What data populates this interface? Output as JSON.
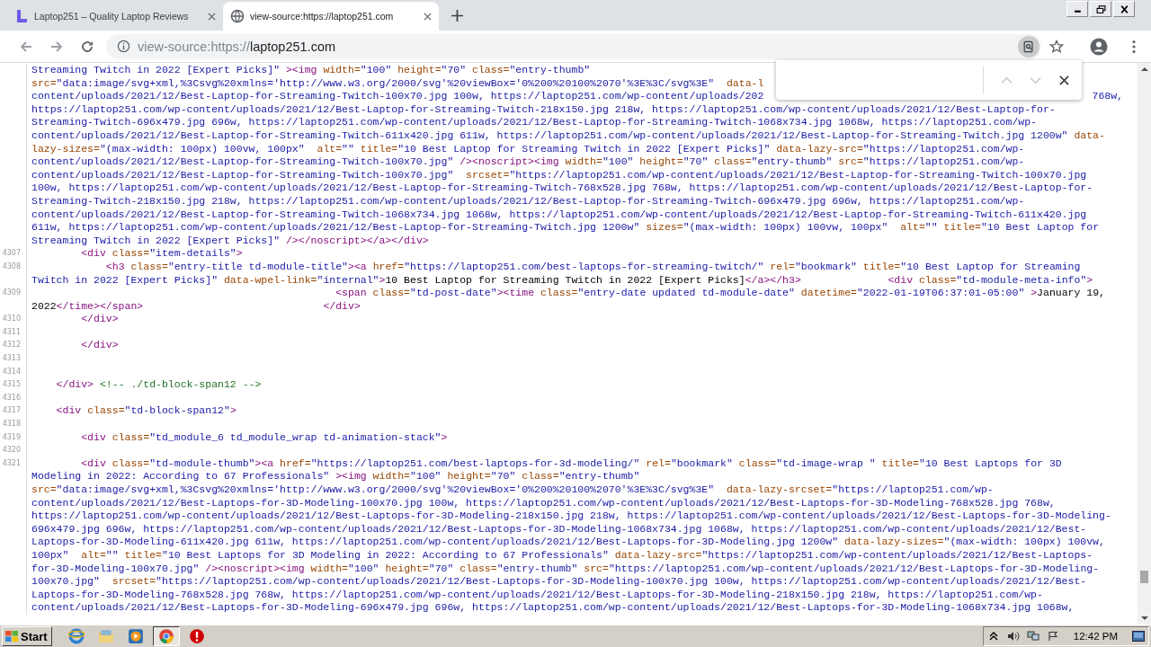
{
  "tabs": [
    {
      "title": "Laptop251 – Quality Laptop Reviews",
      "selected": false
    },
    {
      "title": "view-source:https://laptop251.com",
      "selected": true
    }
  ],
  "address_bar": {
    "scheme": "view-source:https://",
    "host": "laptop251.com"
  },
  "source_lines": [
    {
      "text": "Streaming Twitch in 2022 [Expert Picks]\" ><img width=\"100\" height=\"70\" class=\"entry-thumb\""
    },
    {
      "text": "src=\"data:image/svg+xml,%3Csvg%20xmlns='http://www.w3.org/2000/svg'%20viewBox='0%200%20100%2070'%3E%3C/svg%3E\"  data-l"
    },
    {
      "text": "content/uploads/2021/12/Best-Laptop-for-Streaming-Twitch-100x70.jpg 100w, https://laptop251.com/wp-content/uploads/202",
      "tail": "768w,"
    },
    {
      "text": "https://laptop251.com/wp-content/uploads/2021/12/Best-Laptop-for-Streaming-Twitch-218x150.jpg 218w, https://laptop251.com/wp-content/uploads/2021/12/Best-Laptop-for-"
    },
    {
      "text": "Streaming-Twitch-696x479.jpg 696w, https://laptop251.com/wp-content/uploads/2021/12/Best-Laptop-for-Streaming-Twitch-1068x734.jpg 1068w, https://laptop251.com/wp-"
    },
    {
      "text": "content/uploads/2021/12/Best-Laptop-for-Streaming-Twitch-611x420.jpg 611w, https://laptop251.com/wp-content/uploads/2021/12/Best-Laptop-for-Streaming-Twitch.jpg 1200w\" data-"
    },
    {
      "text": "lazy-sizes=\"(max-width: 100px) 100vw, 100px\"  alt=\"\" title=\"10 Best Laptop for Streaming Twitch in 2022 [Expert Picks]\" data-lazy-src=\"https://laptop251.com/wp-"
    },
    {
      "text": "content/uploads/2021/12/Best-Laptop-for-Streaming-Twitch-100x70.jpg\" /><noscript><img width=\"100\" height=\"70\" class=\"entry-thumb\" src=\"https://laptop251.com/wp-"
    },
    {
      "text": "content/uploads/2021/12/Best-Laptop-for-Streaming-Twitch-100x70.jpg\"  srcset=\"https://laptop251.com/wp-content/uploads/2021/12/Best-Laptop-for-Streaming-Twitch-100x70.jpg"
    },
    {
      "text": "100w, https://laptop251.com/wp-content/uploads/2021/12/Best-Laptop-for-Streaming-Twitch-768x528.jpg 768w, https://laptop251.com/wp-content/uploads/2021/12/Best-Laptop-for-"
    },
    {
      "text": "Streaming-Twitch-218x150.jpg 218w, https://laptop251.com/wp-content/uploads/2021/12/Best-Laptop-for-Streaming-Twitch-696x479.jpg 696w, https://laptop251.com/wp-"
    },
    {
      "text": "content/uploads/2021/12/Best-Laptop-for-Streaming-Twitch-1068x734.jpg 1068w, https://laptop251.com/wp-content/uploads/2021/12/Best-Laptop-for-Streaming-Twitch-611x420.jpg"
    },
    {
      "text": "611w, https://laptop251.com/wp-content/uploads/2021/12/Best-Laptop-for-Streaming-Twitch.jpg 1200w\" sizes=\"(max-width: 100px) 100vw, 100px\"  alt=\"\" title=\"10 Best Laptop for"
    },
    {
      "text": "Streaming Twitch in 2022 [Expert Picks]\" /></noscript></a></div>"
    },
    {
      "number": "4307",
      "text": "        <div class=\"item-details\">"
    },
    {
      "number": "4308",
      "text": "            <h3 class=\"entry-title td-module-title\"><a href=\"https://laptop251.com/best-laptops-for-streaming-twitch/\" rel=\"bookmark\" title=\"10 Best Laptop for Streaming"
    },
    {
      "text": "Twitch in 2022 [Expert Picks]\" data-wpel-link=\"internal\">10 Best Laptop for Streaming Twitch in 2022 [Expert Picks]</a></h3>",
      "more": [
        "              <div class=\"td-module-meta-info\">"
      ]
    },
    {
      "number": "4309",
      "text": "                                                 <span class=\"td-post-date\"><time class=\"entry-date updated td-module-date\" datetime=\"2022-01-19T06:37:01-05:00\" >January 19,"
    },
    {
      "text": "2022</time></span>",
      "more": [
        "                             </div>"
      ]
    },
    {
      "number": "4310",
      "text": "        </div>"
    },
    {
      "number": "4311"
    },
    {
      "number": "4312",
      "text": "        </div>"
    },
    {
      "number": "4313"
    },
    {
      "number": "4314"
    },
    {
      "number": "4315",
      "text": "    </div> <!-- ./td-block-span12 -->"
    },
    {
      "number": "4316"
    },
    {
      "number": "4317",
      "text": "    <div class=\"td-block-span12\">"
    },
    {
      "number": "4318"
    },
    {
      "number": "4319",
      "text": "        <div class=\"td_module_6 td_module_wrap td-animation-stack\">"
    },
    {
      "number": "4320"
    },
    {
      "number": "4321",
      "text": "        <div class=\"td-module-thumb\"><a href=\"https://laptop251.com/best-laptops-for-3d-modeling/\" rel=\"bookmark\" class=\"td-image-wrap \" title=\"10 Best Laptops for 3D"
    },
    {
      "text": "Modeling in 2022: According to 67 Professionals\" ><img width=\"100\" height=\"70\" class=\"entry-thumb\""
    },
    {
      "text": "src=\"data:image/svg+xml,%3Csvg%20xmlns='http://www.w3.org/2000/svg'%20viewBox='0%200%20100%2070'%3E%3C/svg%3E\"  data-lazy-srcset=\"https://laptop251.com/wp-"
    },
    {
      "text": "content/uploads/2021/12/Best-Laptops-for-3D-Modeling-100x70.jpg 100w, https://laptop251.com/wp-content/uploads/2021/12/Best-Laptops-for-3D-Modeling-768x528.jpg 768w,"
    },
    {
      "text": "https://laptop251.com/wp-content/uploads/2021/12/Best-Laptops-for-3D-Modeling-218x150.jpg 218w, https://laptop251.com/wp-content/uploads/2021/12/Best-Laptops-for-3D-Modeling-"
    },
    {
      "text": "696x479.jpg 696w, https://laptop251.com/wp-content/uploads/2021/12/Best-Laptops-for-3D-Modeling-1068x734.jpg 1068w, https://laptop251.com/wp-content/uploads/2021/12/Best-"
    },
    {
      "text": "Laptops-for-3D-Modeling-611x420.jpg 611w, https://laptop251.com/wp-content/uploads/2021/12/Best-Laptops-for-3D-Modeling.jpg 1200w\" data-lazy-sizes=\"(max-width: 100px) 100vw,"
    },
    {
      "text": "100px\"  alt=\"\" title=\"10 Best Laptops for 3D Modeling in 2022: According to 67 Professionals\" data-lazy-src=\"https://laptop251.com/wp-content/uploads/2021/12/Best-Laptops-"
    },
    {
      "text": "for-3D-Modeling-100x70.jpg\" /><noscript><img width=\"100\" height=\"70\" class=\"entry-thumb\" src=\"https://laptop251.com/wp-content/uploads/2021/12/Best-Laptops-for-3D-Modeling-"
    },
    {
      "text": "100x70.jpg\"  srcset=\"https://laptop251.com/wp-content/uploads/2021/12/Best-Laptops-for-3D-Modeling-100x70.jpg 100w, https://laptop251.com/wp-content/uploads/2021/12/Best-"
    },
    {
      "text": "Laptops-for-3D-Modeling-768x528.jpg 768w, https://laptop251.com/wp-content/uploads/2021/12/Best-Laptops-for-3D-Modeling-218x150.jpg 218w, https://laptop251.com/wp-"
    },
    {
      "text": "content/uploads/2021/12/Best-Laptops-for-3D-Modeling-696x479.jpg 696w, https://laptop251.com/wp-content/uploads/2021/12/Best-Laptops-for-3D-Modeling-1068x734.jpg 1068w,"
    }
  ],
  "taskbar": {
    "start": "Start",
    "clock": "12:42 PM"
  }
}
